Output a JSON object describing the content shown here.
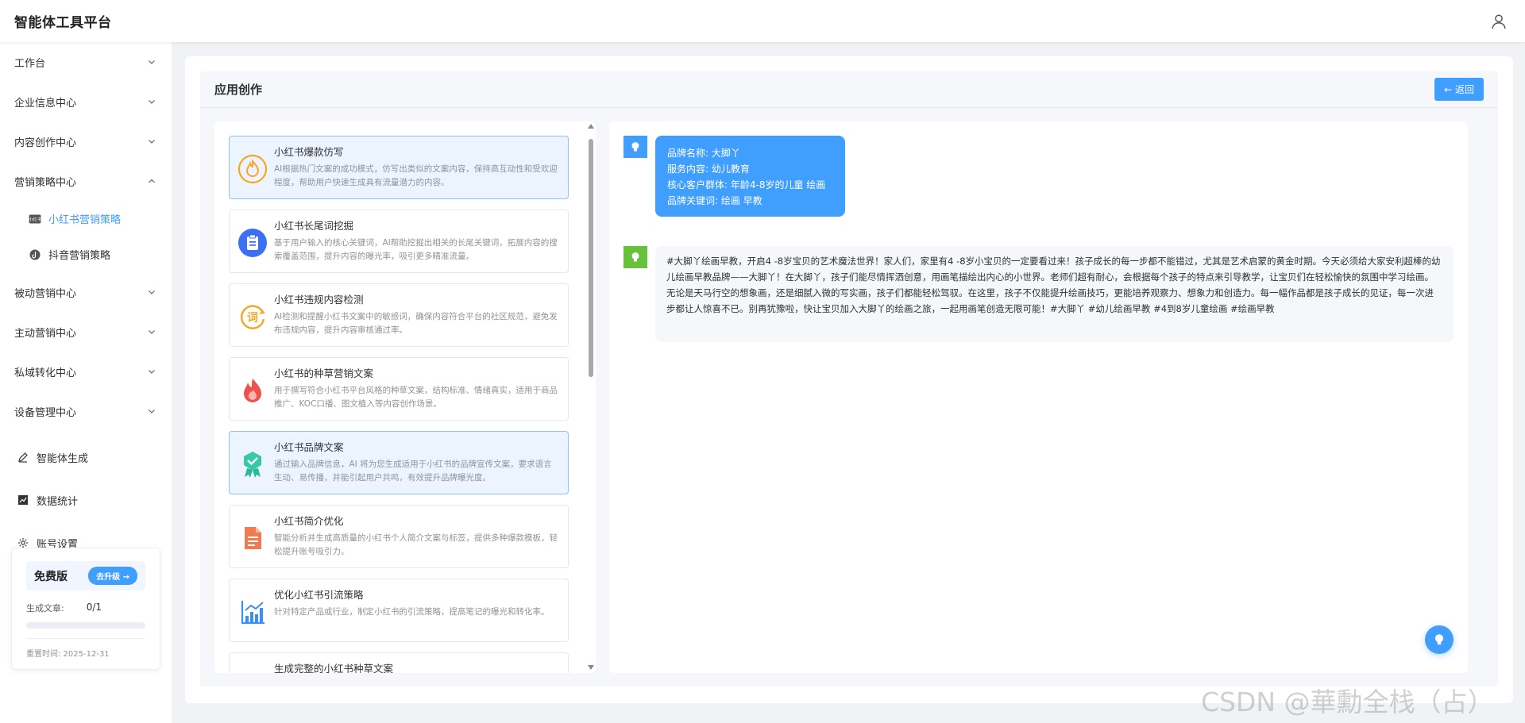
{
  "header": {
    "title": "智能体工具平台"
  },
  "sidebar": {
    "groups_top": [
      {
        "label": "工作台"
      },
      {
        "label": "企业信息中心"
      },
      {
        "label": "内容创作中心"
      },
      {
        "label": "营销策略中心"
      }
    ],
    "sub_items": [
      {
        "label": "小红书营销策略",
        "active": true
      },
      {
        "label": "抖音营销策略",
        "active": false
      }
    ],
    "groups_bottom": [
      {
        "label": "被动营销中心"
      },
      {
        "label": "主动营销中心"
      },
      {
        "label": "私域转化中心"
      },
      {
        "label": "设备管理中心"
      }
    ],
    "plain_items": [
      {
        "label": "智能体生成"
      },
      {
        "label": "数据统计"
      },
      {
        "label": "账号设置"
      }
    ],
    "plan": {
      "name": "免费版",
      "upgrade_label": "去升级 →",
      "usage_label": "生成文章:",
      "usage_value": "0/1",
      "usage_fraction": 0,
      "reset_text": "重置时间: 2025-12-31"
    }
  },
  "page": {
    "title": "应用创作",
    "back_label": "← 返回"
  },
  "tools": [
    {
      "name": "小红书爆款仿写",
      "desc": "AI根据热门文案的成功模式，仿写出类似的文案内容，保持高互动性和受欢迎程度，帮助用户快速生成具有流量潜力的内容。",
      "selected": true
    },
    {
      "name": "小红书长尾词挖掘",
      "desc": "基于用户输入的核心关键词，AI帮助挖掘出相关的长尾关键词，拓展内容的搜索覆盖范围，提升内容的曝光率，吸引更多精准流量。",
      "selected": false
    },
    {
      "name": "小红书违规内容检测",
      "desc": "AI检测和提醒小红书文案中的敏感词，确保内容符合平台的社区规范，避免发布违规内容，提升内容审核通过率。",
      "selected": false
    },
    {
      "name": "小红书的种草营销文案",
      "desc": "用于撰写符合小红书平台风格的种草文案，结构标准、情绪真实，适用于商品推广、KOC口播、图文植入等内容创作场景。",
      "selected": false
    },
    {
      "name": "小红书品牌文案",
      "desc": "通过输入品牌信息，AI 将为您生成适用于小红书的品牌宣传文案，要求语言生动、易传播，并能引起用户共鸣，有效提升品牌曝光度。",
      "selected": true
    },
    {
      "name": "小红书简介优化",
      "desc": "智能分析并生成高质量的小红书个人简介文案与标签，提供多种爆款模板，轻松提升账号吸引力。",
      "selected": false
    },
    {
      "name": "优化小红书引流策略",
      "desc": "针对特定产品或行业，制定小红书的引流策略，提高笔记的曝光和转化率。",
      "selected": false
    },
    {
      "name": "生成完整的小红书种草文案",
      "desc": "",
      "selected": false
    }
  ],
  "chat": {
    "user_lines": [
      "品牌名称: 大脚丫",
      "服务内容: 幼儿教育",
      "核心客户群体: 年龄4-8岁的儿童 绘画",
      "品牌关键词: 绘画 早教"
    ],
    "bot_text": "#大脚丫绘画早教，开启4 -8岁宝贝的艺术魔法世界！家人们，家里有4 -8岁小宝贝的一定要看过来！孩子成长的每一步都不能错过，尤其是艺术启蒙的黄金时期。今天必须给大家安利超棒的幼儿绘画早教品牌——大脚丫！在大脚丫，孩子们能尽情挥洒创意，用画笔描绘出内心的小世界。老师们超有耐心，会根据每个孩子的特点来引导教学，让宝贝们在轻松愉快的氛围中学习绘画。无论是天马行空的想象画，还是细腻入微的写实画，孩子们都能轻松驾驭。在这里，孩子不仅能提升绘画技巧，更能培养观察力、想象力和创造力。每一幅作品都是孩子成长的见证，每一次进步都让人惊喜不已。别再犹豫啦，快让宝贝加入大脚丫的绘画之旅，一起用画笔创造无限可能！#大脚丫 #幼儿绘画早教 #4到8岁儿童绘画 #绘画早教"
  },
  "watermark": "CSDN @華勳全栈（占）",
  "colors": {
    "primary": "#409eff",
    "bot_avatar": "#67c23a",
    "selected_bg": "#ecf5ff"
  }
}
